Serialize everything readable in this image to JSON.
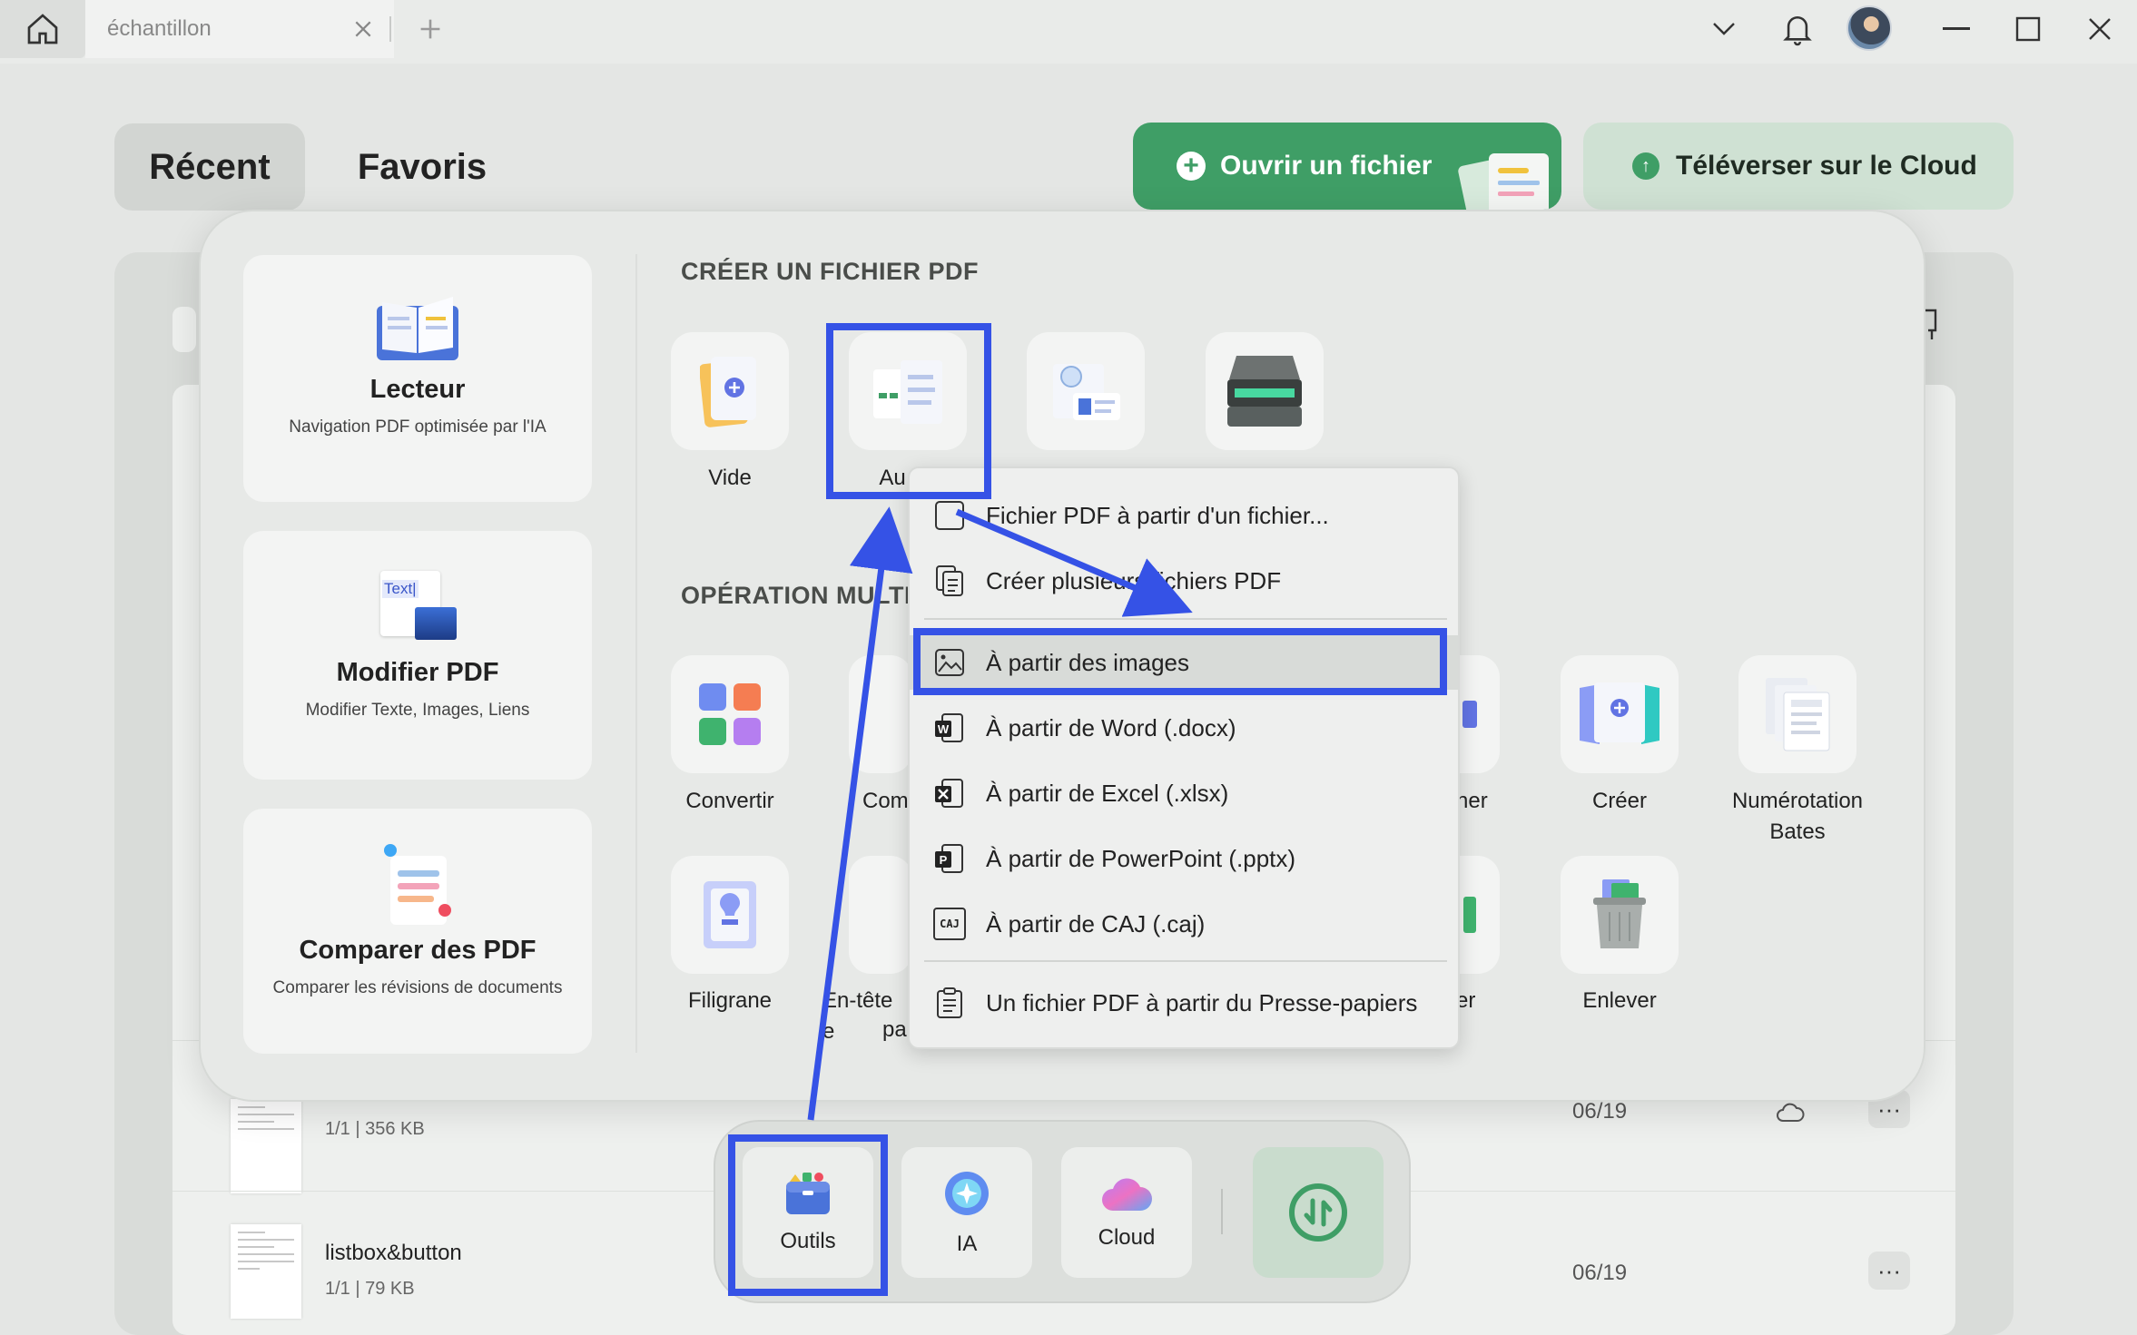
{
  "titlebar": {
    "tab_title": "échantillon"
  },
  "header": {
    "tab_recent": "Récent",
    "tab_favorites": "Favoris",
    "open_file_label": "Ouvrir un fichier",
    "upload_cloud_label": "Téléverser sur le Cloud"
  },
  "cards": [
    {
      "title": "Lecteur",
      "desc": "Navigation PDF optimisée par l'IA"
    },
    {
      "title": "Modifier PDF",
      "desc": "Modifier Texte, Images, Liens",
      "icon_text": "Text|"
    },
    {
      "title": "Comparer des PDF",
      "desc": "Comparer les révisions de documents"
    }
  ],
  "create_section": {
    "title": "CRÉER UN FICHIER PDF",
    "tools": [
      "Vide",
      "Au"
    ]
  },
  "multi_section": {
    "title": "OPÉRATION MULTI",
    "row1": [
      "Convertir",
      "Com",
      "ner",
      "Créer",
      "Numérotation Bates"
    ],
    "row2": [
      "Filigrane",
      "En-tête e",
      "pa",
      "er",
      "Enlever"
    ]
  },
  "menu": {
    "items": [
      "Fichier PDF à partir d'un fichier...",
      "Créer plusieurs fichiers PDF",
      "À partir des images",
      "À partir de Word (.docx)",
      "À partir de Excel (.xlsx)",
      "À partir de PowerPoint (.pptx)",
      "À partir de CAJ (.caj)",
      "Un fichier PDF à partir du Presse-papiers"
    ],
    "caj_icon_text": "CAJ"
  },
  "files": [
    {
      "name": "",
      "meta": "1/1 | 356 KB",
      "date": "06/19"
    },
    {
      "name": "listbox&button",
      "meta": "1/1 | 79 KB",
      "date": "06/19"
    }
  ],
  "dock": {
    "tools": "Outils",
    "ai": "IA",
    "cloud": "Cloud"
  },
  "colors": {
    "accent_green": "#3f9e66",
    "annotation_blue": "#3552e6"
  }
}
